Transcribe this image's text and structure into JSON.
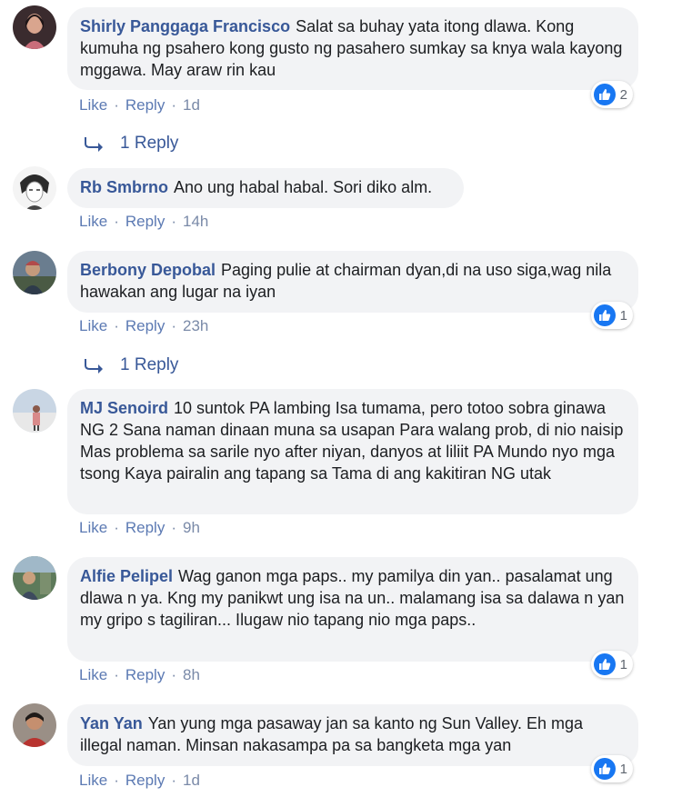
{
  "actions": {
    "like": "Like",
    "reply": "Reply",
    "separator": "·"
  },
  "comments": [
    {
      "author": "Shirly Panggaga Francisco",
      "text": "Salat sa buhay yata itong dlawa. Kong kumuha ng psahero kong gusto ng pasahero sumkay sa knya wala kayong mggawa. May araw rin kau",
      "time": "1d",
      "reactions": "2",
      "reply_label": "1 Reply",
      "avatar_colors": [
        "#3a2b2e",
        "#c96d7a"
      ]
    },
    {
      "author": "Rb Smbrno",
      "text": "Ano ung habal habal. Sori diko alm.",
      "time": "14h",
      "avatar_colors": [
        "#f4f4f4",
        "#2b2b2b"
      ]
    },
    {
      "author": "Berbony Depobal",
      "text": "Paging pulie at chairman dyan,di na uso siga,wag nila hawakan ang lugar na iyan",
      "time": "23h",
      "reactions": "1",
      "reply_label": "1 Reply",
      "avatar_colors": [
        "#6a7d8f",
        "#b24a4a"
      ]
    },
    {
      "author": "MJ Senoird",
      "text": "10 suntok PA lambing Isa tumama, pero totoo sobra ginawa NG 2 Sana naman dinaan muna sa usapan Para walang prob, di nio naisip Mas problema sa sarile nyo after niyan, danyos at liliit PA Mundo nyo mga tsong Kaya pairalin ang tapang sa Tama di ang kakitiran NG utak",
      "time": "9h",
      "avatar_colors": [
        "#c9d6e4",
        "#d88a8a"
      ]
    },
    {
      "author": "Alfie Pelipel",
      "text": "Wag ganon mga paps.. my pamilya din yan.. pasalamat ung dlawa n ya. Kng my panikwt ung isa na un.. malamang isa sa dalawa n yan my gripo s tagiliran... Ilugaw nio tapang nio mga paps..",
      "time": "8h",
      "reactions": "1",
      "avatar_colors": [
        "#5d7a5a",
        "#a0b8c8"
      ]
    },
    {
      "author": "Yan Yan",
      "text": "Yan yung mga pasaway jan sa kanto ng Sun Valley. Eh mga illegal naman. Minsan nakasampa pa sa bangketa mga yan",
      "time": "1d",
      "reactions": "1",
      "avatar_colors": [
        "#9a8f86",
        "#b8332f"
      ]
    }
  ],
  "colors": {
    "author": "#385898",
    "bubble": "#f2f3f5",
    "link": "#5c7ab3",
    "like_badge": "#1877f2"
  },
  "icons": {
    "reaction": "thumbs-up-icon",
    "reply": "reply-arrow-icon"
  }
}
